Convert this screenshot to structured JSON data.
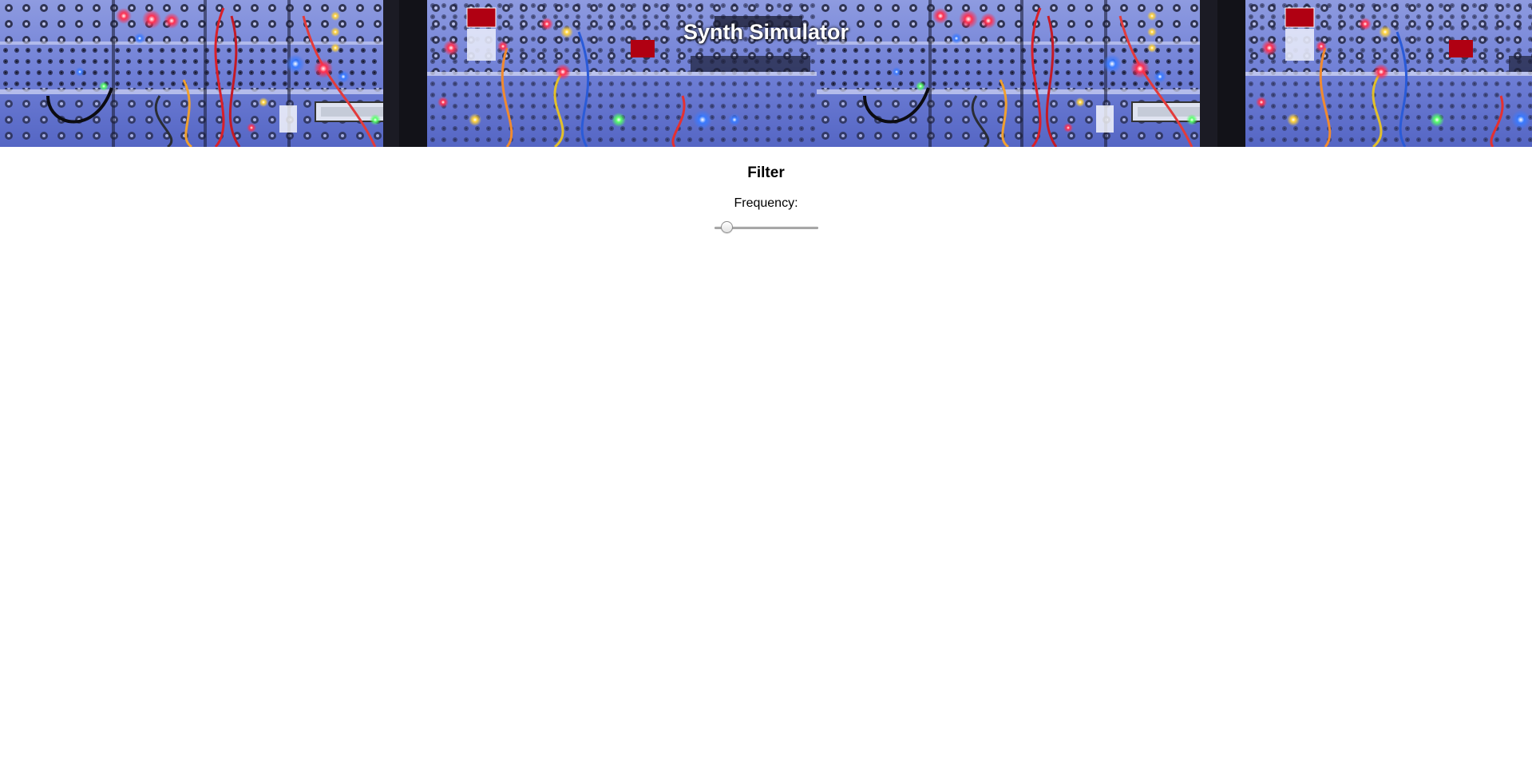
{
  "header": {
    "title": "Synth Simulator",
    "background_image": "modular-synth-panels"
  },
  "filter": {
    "heading": "Filter",
    "frequency_label": "Frequency:",
    "frequency_slider_fraction": 0.12
  },
  "colors": {
    "banner_base": "#1a1c3a",
    "title_text": "#ffffff"
  }
}
